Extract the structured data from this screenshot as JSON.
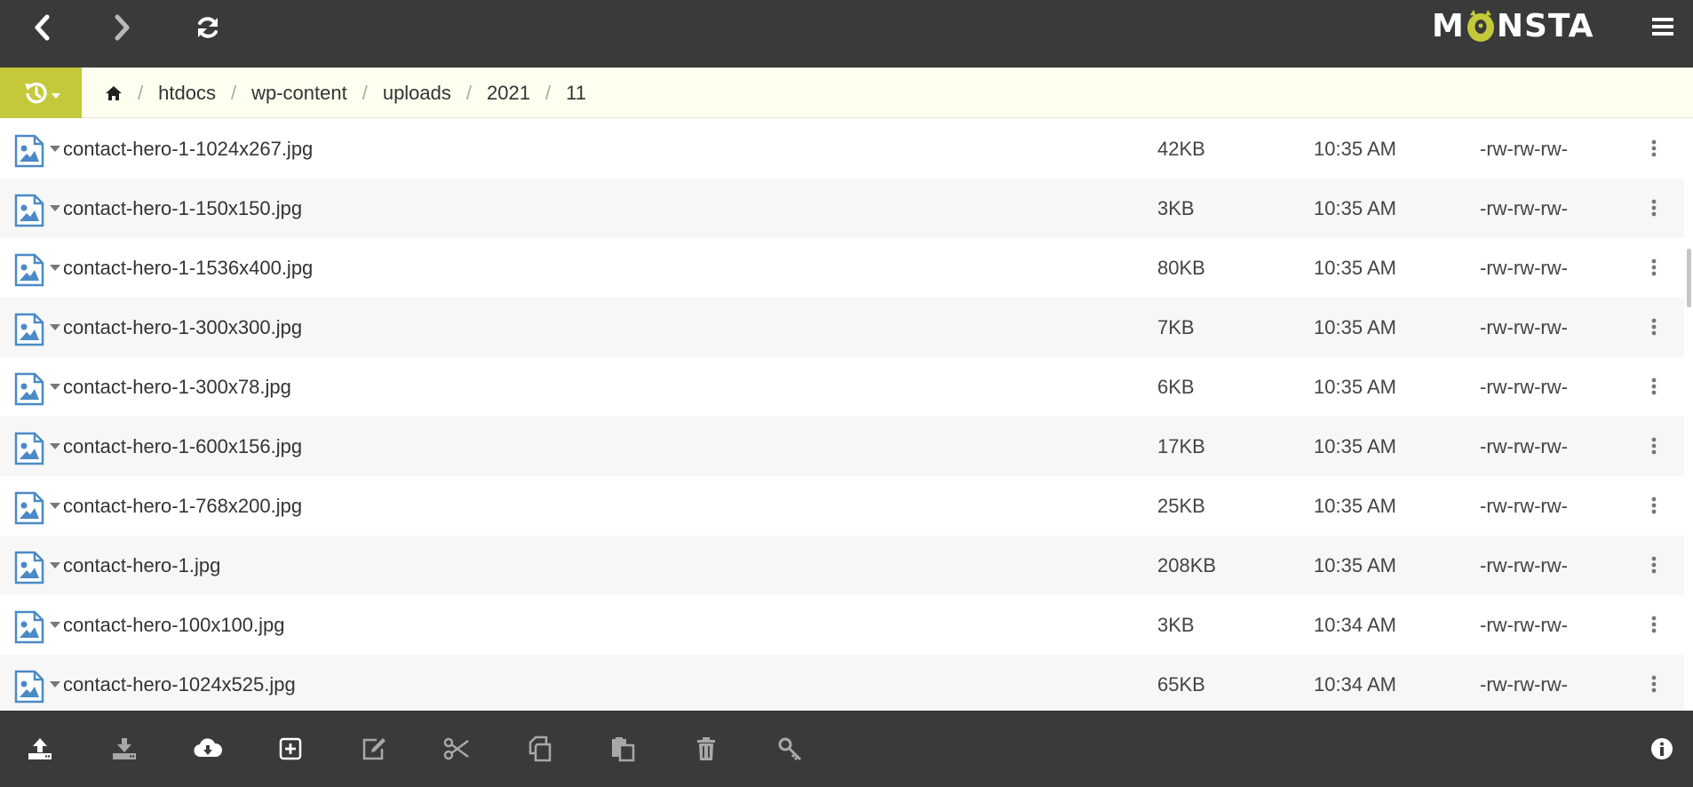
{
  "app": {
    "logo_text_left": "M",
    "logo_text_right": "NSTA",
    "brand_color": "#c3c93a",
    "bar_color": "#3a3a3a"
  },
  "toolbar_top": {
    "back_icon": "chevron-left-icon",
    "forward_icon": "chevron-right-icon",
    "refresh_icon": "refresh-icon",
    "menu_icon": "hamburger-menu-icon"
  },
  "breadcrumb": {
    "history_icon": "history-icon",
    "home_icon": "home-icon",
    "separator": "/",
    "items": [
      "htdocs",
      "wp-content",
      "uploads",
      "2021",
      "11"
    ]
  },
  "files": [
    {
      "name": "contact-hero-1-1024x267.jpg",
      "size": "42KB",
      "time": "10:35 AM",
      "perms": "-rw-rw-rw-"
    },
    {
      "name": "contact-hero-1-150x150.jpg",
      "size": "3KB",
      "time": "10:35 AM",
      "perms": "-rw-rw-rw-"
    },
    {
      "name": "contact-hero-1-1536x400.jpg",
      "size": "80KB",
      "time": "10:35 AM",
      "perms": "-rw-rw-rw-"
    },
    {
      "name": "contact-hero-1-300x300.jpg",
      "size": "7KB",
      "time": "10:35 AM",
      "perms": "-rw-rw-rw-"
    },
    {
      "name": "contact-hero-1-300x78.jpg",
      "size": "6KB",
      "time": "10:35 AM",
      "perms": "-rw-rw-rw-"
    },
    {
      "name": "contact-hero-1-600x156.jpg",
      "size": "17KB",
      "time": "10:35 AM",
      "perms": "-rw-rw-rw-"
    },
    {
      "name": "contact-hero-1-768x200.jpg",
      "size": "25KB",
      "time": "10:35 AM",
      "perms": "-rw-rw-rw-"
    },
    {
      "name": "contact-hero-1.jpg",
      "size": "208KB",
      "time": "10:35 AM",
      "perms": "-rw-rw-rw-"
    },
    {
      "name": "contact-hero-100x100.jpg",
      "size": "3KB",
      "time": "10:34 AM",
      "perms": "-rw-rw-rw-"
    },
    {
      "name": "contact-hero-1024x525.jpg",
      "size": "65KB",
      "time": "10:34 AM",
      "perms": "-rw-rw-rw-"
    }
  ],
  "toolbar_bottom": {
    "icons": [
      "upload-icon",
      "download-icon",
      "cloud-download-icon",
      "new-item-icon",
      "edit-icon",
      "cut-icon",
      "copy-icon",
      "paste-icon",
      "delete-icon",
      "key-icon",
      "info-icon"
    ]
  }
}
